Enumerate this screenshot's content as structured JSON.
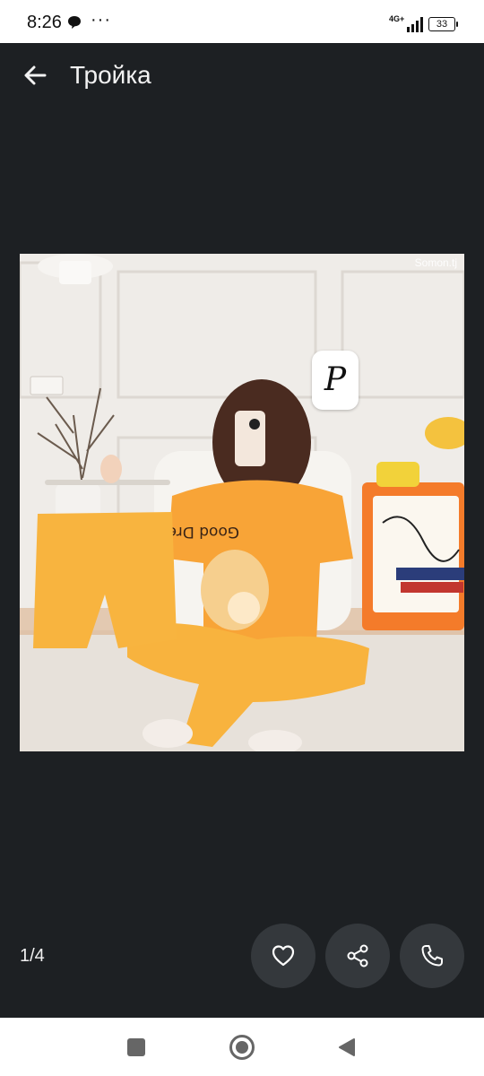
{
  "status_bar": {
    "time": "8:26",
    "network": "4G+",
    "battery": "33"
  },
  "app_bar": {
    "title": "Тройка"
  },
  "photo": {
    "watermark": "Somon.tj",
    "badge_letter": "P",
    "shirt_print": "Good Dream"
  },
  "gallery": {
    "counter": "1/4"
  },
  "colors": {
    "background": "#1d2023",
    "button_bg": "#34383c",
    "pajama_orange": "#f7a73d"
  }
}
